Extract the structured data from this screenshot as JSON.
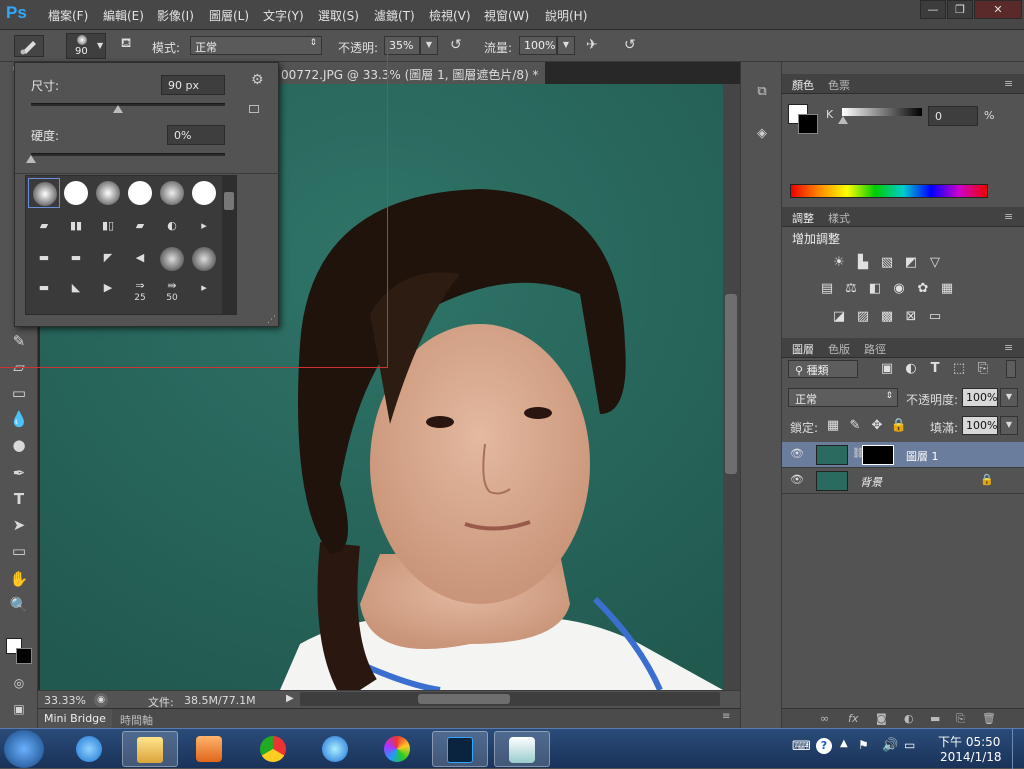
{
  "app": {
    "logo": "Ps",
    "title": "00772.JPG @ 33.3% (圖層 1, 圖層遮色片/8) *",
    "tab_close": "×"
  },
  "menu": [
    "檔案(F)",
    "編輯(E)",
    "影像(I)",
    "圖層(L)",
    "文字(Y)",
    "選取(S)",
    "濾鏡(T)",
    "檢視(V)",
    "視窗(W)",
    "說明(H)"
  ],
  "window_controls": {
    "minimize": "—",
    "restore": "❐",
    "close": "✕"
  },
  "options": {
    "brush_size": "90",
    "mode_label": "模式:",
    "mode_value": "正常",
    "opacity_label": "不透明:",
    "opacity_value": "35%",
    "flow_label": "流量:",
    "flow_value": "100%"
  },
  "brush_panel": {
    "size_label": "尺寸:",
    "size_value": "90 px",
    "size_fraction": 0.45,
    "hardness_label": "硬度:",
    "hardness_value": "0%",
    "hardness_fraction": 0.0,
    "brush_numbers": [
      "25",
      "50"
    ]
  },
  "status": {
    "zoom": "33.33%",
    "doc_label": "文件:",
    "doc_size": "38.5M/77.1M"
  },
  "bottom_tabs": [
    "Mini Bridge",
    "時間軸"
  ],
  "color_panel": {
    "tabs": [
      "顏色",
      "色票"
    ],
    "channel_label": "K",
    "channel_value": "0",
    "channel_unit": "%"
  },
  "adjust_panel": {
    "tabs": [
      "調整",
      "樣式"
    ],
    "heading": "增加調整"
  },
  "layers_panel": {
    "tabs": [
      "圖層",
      "色版",
      "路徑"
    ],
    "filter_label": "種類",
    "blend_mode": "正常",
    "opacity_label": "不透明度:",
    "opacity_value": "100%",
    "lock_label": "鎖定:",
    "fill_label": "填滿:",
    "fill_value": "100%",
    "layers": [
      {
        "name": "圖層 1",
        "selected": true,
        "has_mask": true
      },
      {
        "name": "背景",
        "selected": false,
        "locked": true
      }
    ]
  },
  "taskbar": {
    "time": "下午 05:50",
    "date": "2014/1/18"
  },
  "colors": {
    "accent": "#31a8ff",
    "photo_bg": "#2a6a5f",
    "panel": "#535353",
    "dark": "#282828"
  }
}
